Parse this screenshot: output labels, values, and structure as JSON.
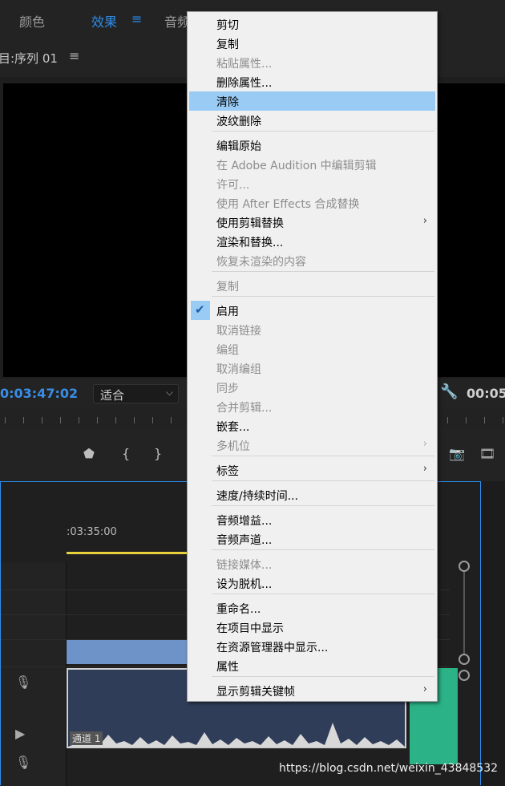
{
  "tabs": {
    "color": "颜色",
    "effects": "效果",
    "audio": "音频",
    "menu_icon": "hamburger-icon"
  },
  "program_monitor": {
    "title": "目:序列 01",
    "menu_icon": "hamburger-icon",
    "timecode_left": "0:03:47:02",
    "fit_select": "适合",
    "timecode_right": "00:05"
  },
  "timeline": {
    "time_label": ":03:35:00",
    "channel_label": "通道 1"
  },
  "context_menu": {
    "items": [
      {
        "label": "剪切",
        "enabled": true
      },
      {
        "label": "复制",
        "enabled": true
      },
      {
        "label": "粘贴属性...",
        "enabled": false
      },
      {
        "label": "删除属性...",
        "enabled": true
      },
      {
        "label": "清除",
        "enabled": true,
        "highlighted": true
      },
      {
        "label": "波纹删除",
        "enabled": true
      },
      {
        "label": "编辑原始",
        "enabled": true
      },
      {
        "label": "在 Adobe Audition 中编辑剪辑",
        "enabled": false
      },
      {
        "label": "许可...",
        "enabled": false
      },
      {
        "label": "使用 After Effects 合成替换",
        "enabled": false
      },
      {
        "label": "使用剪辑替换",
        "enabled": true,
        "submenu": true
      },
      {
        "label": "渲染和替换...",
        "enabled": true
      },
      {
        "label": "恢复未渲染的内容",
        "enabled": false
      },
      {
        "label": "复制",
        "enabled": false
      },
      {
        "label": "启用",
        "enabled": true,
        "checked": true
      },
      {
        "label": "取消链接",
        "enabled": false
      },
      {
        "label": "编组",
        "enabled": false
      },
      {
        "label": "取消编组",
        "enabled": false
      },
      {
        "label": "同步",
        "enabled": false
      },
      {
        "label": "合并剪辑...",
        "enabled": false
      },
      {
        "label": "嵌套...",
        "enabled": true
      },
      {
        "label": "多机位",
        "enabled": false,
        "submenu": true
      },
      {
        "label": "标签",
        "enabled": true,
        "submenu": true
      },
      {
        "label": "速度/持续时间...",
        "enabled": true
      },
      {
        "label": "音频增益...",
        "enabled": true
      },
      {
        "label": "音频声道...",
        "enabled": true
      },
      {
        "label": "链接媒体...",
        "enabled": false
      },
      {
        "label": "设为脱机...",
        "enabled": true
      },
      {
        "label": "重命名...",
        "enabled": true
      },
      {
        "label": "在项目中显示",
        "enabled": true
      },
      {
        "label": "在资源管理器中显示...",
        "enabled": true
      },
      {
        "label": "属性",
        "enabled": true
      },
      {
        "label": "显示剪辑关键帧",
        "enabled": true,
        "submenu": true
      }
    ]
  },
  "watermark": "https://blog.csdn.net/weixin_43848532",
  "colors": {
    "accent": "#2d8ceb",
    "menu_highlight": "#99cbf5",
    "playhead": "#e8d13a",
    "video_clip": "#6d93c8",
    "audio_clip": "#2f3d59",
    "green_clip": "#2bb287"
  }
}
